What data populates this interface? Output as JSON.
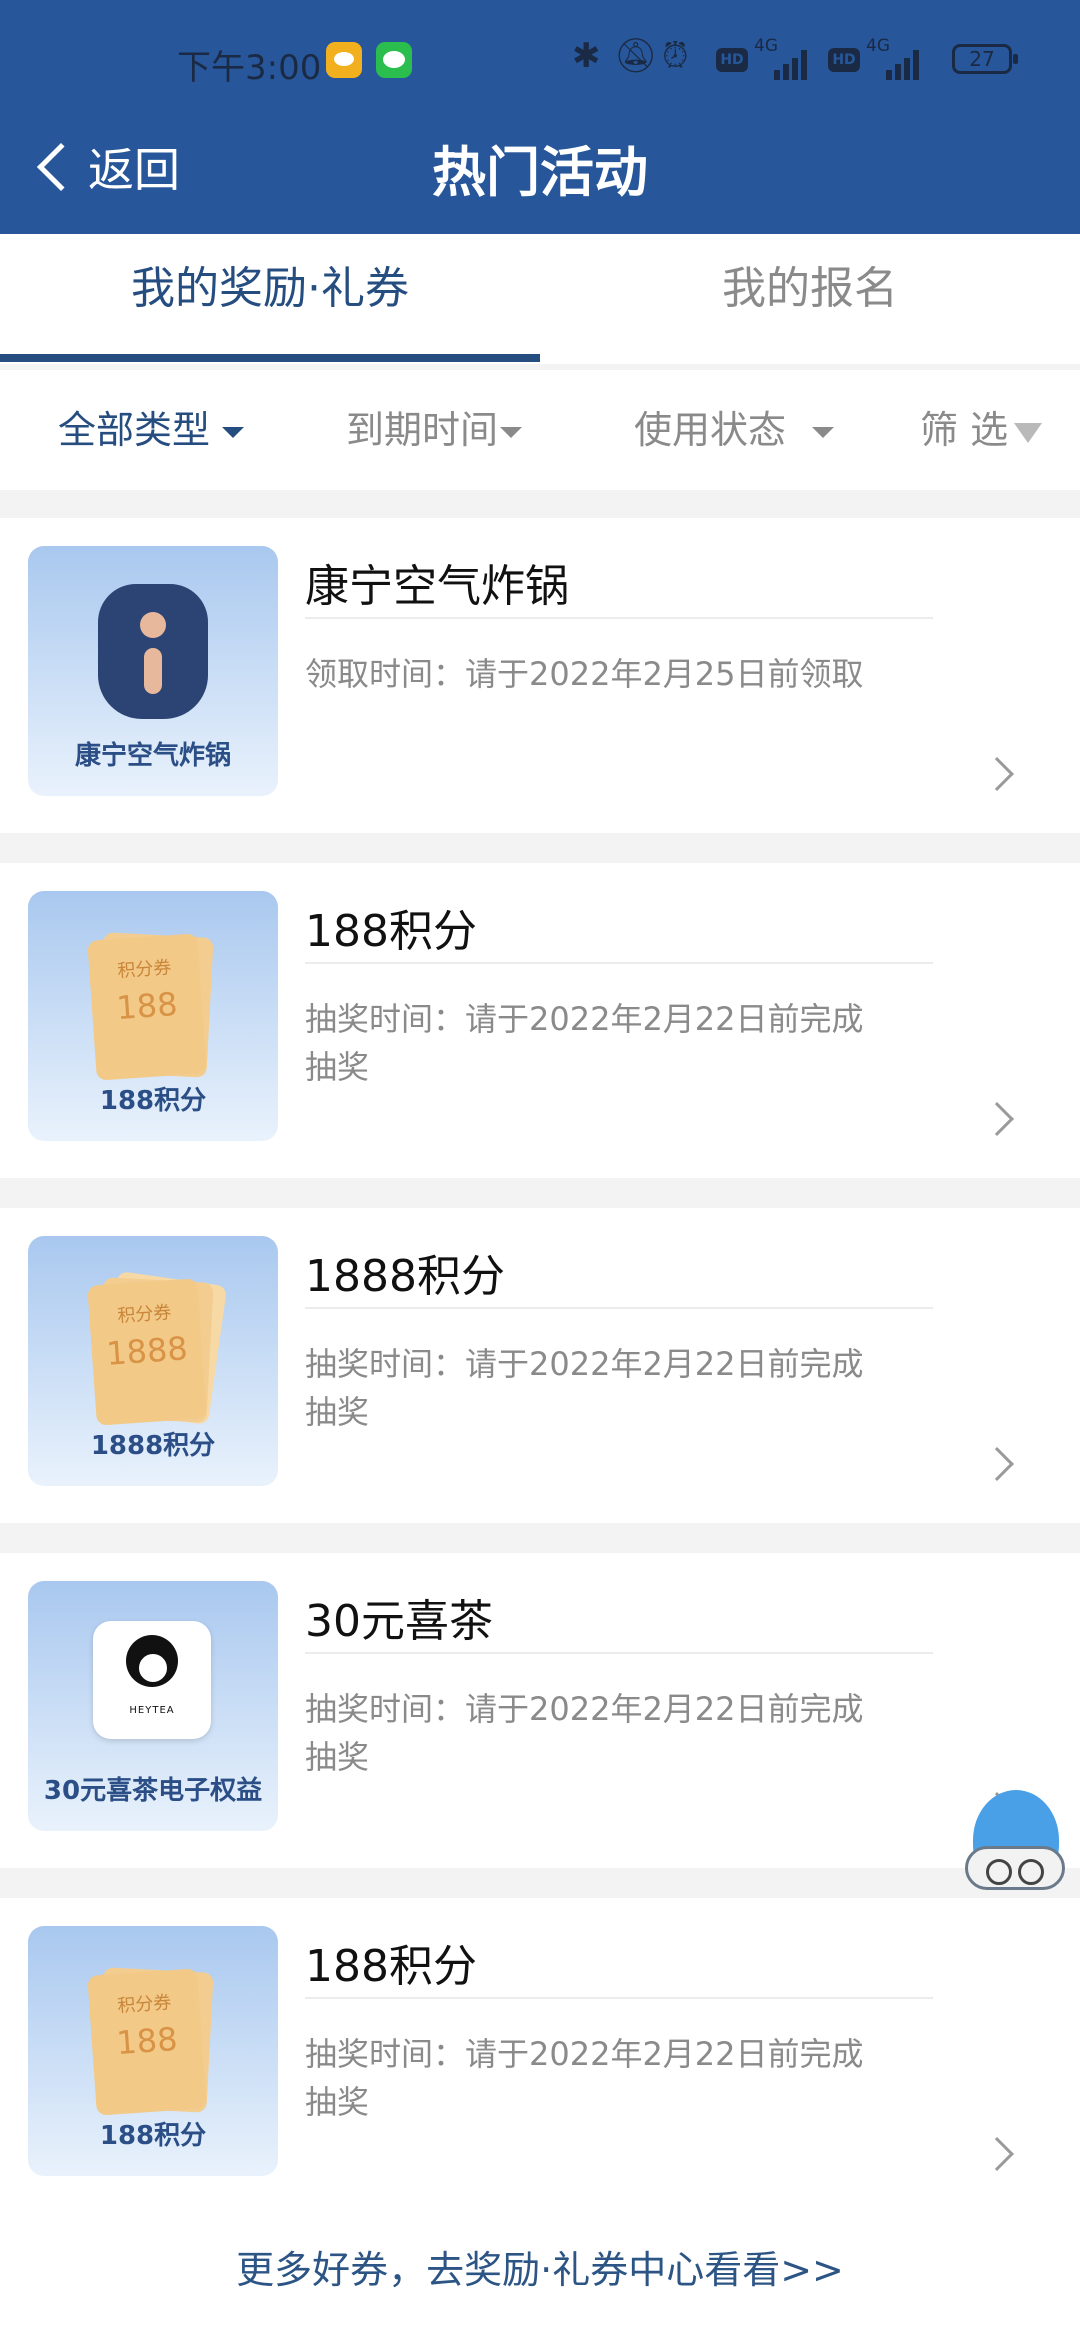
{
  "status_bar": {
    "time": "下午3:00",
    "network_1": "4G",
    "hd_1": "HD",
    "network_2": "4G",
    "hd_2": "HD",
    "battery": "27"
  },
  "header": {
    "back_label": "返回",
    "title": "热门活动"
  },
  "tabs": [
    {
      "label": "我的奖励·礼券",
      "active": true
    },
    {
      "label": "我的报名",
      "active": false
    }
  ],
  "filters": [
    {
      "label": "全部类型",
      "active": true
    },
    {
      "label": "到期时间",
      "active": false
    },
    {
      "label": "使用状态",
      "active": false
    },
    {
      "label": "筛 选",
      "active": false
    }
  ],
  "rewards": [
    {
      "title": "康宁空气炸锅",
      "thumb_caption": "康宁空气炸锅",
      "desc": "领取时间：请于2022年2月25日前领取",
      "thumb_icon": "air-fryer-image"
    },
    {
      "title": "188积分",
      "thumb_caption": "188积分",
      "desc": "抽奖时间：请于2022年2月22日前完成抽奖",
      "thumb_icon": "points-coupon-image",
      "coupon_label": "积分券",
      "coupon_value": "188"
    },
    {
      "title": "1888积分",
      "thumb_caption": "1888积分",
      "desc": "抽奖时间：请于2022年2月22日前完成抽奖",
      "thumb_icon": "points-coupon-image",
      "coupon_label": "积分券",
      "coupon_value": "1888"
    },
    {
      "title": "30元喜茶",
      "thumb_caption": "30元喜茶电子权益",
      "desc": "抽奖时间：请于2022年2月22日前完成抽奖",
      "thumb_icon": "heytea-logo",
      "logo_text": "HEYTEA"
    },
    {
      "title": "188积分",
      "thumb_caption": "188积分",
      "desc": "抽奖时间：请于2022年2月22日前完成抽奖",
      "thumb_icon": "points-coupon-image",
      "coupon_label": "积分券",
      "coupon_value": "188"
    }
  ],
  "footer": {
    "link_text": "更多好券，去奖励·礼券中心看看>>"
  },
  "colors": {
    "header_bg": "#27579a",
    "accent": "#264d80",
    "text_muted": "#8a8a8a"
  }
}
